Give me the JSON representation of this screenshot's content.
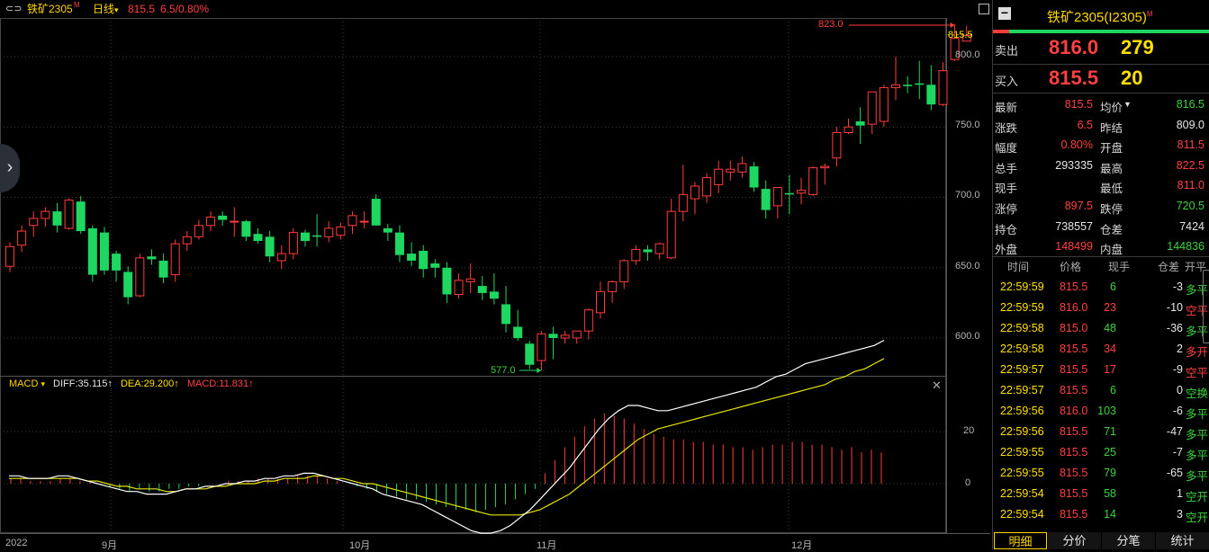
{
  "header": {
    "symbol": "铁矿2305",
    "symbol_mark": "M",
    "period": "日线",
    "period_caret": "▾",
    "price": "815.5",
    "change": "6.5/0.80%"
  },
  "price_axis": {
    "ticks": [
      "800.0",
      "750.0",
      "700.0",
      "650.0",
      "600.0"
    ],
    "current": "815.5"
  },
  "markers": {
    "high": "823.0",
    "low": "577.0"
  },
  "macd": {
    "name": "MACD",
    "caret": "▾",
    "diff": "DIFF:35.115↑",
    "dea": "DEA:29.200↑",
    "macd_val": "MACD:11.831↑",
    "ticks": [
      "20",
      "0"
    ]
  },
  "time_axis": [
    "2022",
    "9月",
    "10月",
    "11月",
    "12月"
  ],
  "chart_data": {
    "type": "candlestick",
    "ylim": [
      570,
      830
    ],
    "candles": [
      {
        "o": 651,
        "h": 668,
        "l": 647,
        "c": 665
      },
      {
        "o": 666,
        "h": 680,
        "l": 661,
        "c": 676
      },
      {
        "o": 680,
        "h": 690,
        "l": 672,
        "c": 685
      },
      {
        "o": 685,
        "h": 693,
        "l": 679,
        "c": 690
      },
      {
        "o": 690,
        "h": 696,
        "l": 675,
        "c": 680
      },
      {
        "o": 678,
        "h": 699,
        "l": 677,
        "c": 698
      },
      {
        "o": 697,
        "h": 701,
        "l": 674,
        "c": 676
      },
      {
        "o": 678,
        "h": 680,
        "l": 640,
        "c": 645
      },
      {
        "o": 675,
        "h": 679,
        "l": 645,
        "c": 648
      },
      {
        "o": 660,
        "h": 662,
        "l": 640,
        "c": 648
      },
      {
        "o": 647,
        "h": 651,
        "l": 624,
        "c": 629
      },
      {
        "o": 630,
        "h": 660,
        "l": 629,
        "c": 657
      },
      {
        "o": 658,
        "h": 663,
        "l": 652,
        "c": 656
      },
      {
        "o": 655,
        "h": 660,
        "l": 639,
        "c": 643
      },
      {
        "o": 645,
        "h": 670,
        "l": 640,
        "c": 667
      },
      {
        "o": 667,
        "h": 676,
        "l": 662,
        "c": 672
      },
      {
        "o": 672,
        "h": 684,
        "l": 670,
        "c": 680
      },
      {
        "o": 680,
        "h": 690,
        "l": 676,
        "c": 686
      },
      {
        "o": 687,
        "h": 690,
        "l": 680,
        "c": 684
      },
      {
        "o": 683,
        "h": 693,
        "l": 672,
        "c": 683
      },
      {
        "o": 683,
        "h": 684,
        "l": 669,
        "c": 672
      },
      {
        "o": 674,
        "h": 678,
        "l": 667,
        "c": 669
      },
      {
        "o": 672,
        "h": 676,
        "l": 654,
        "c": 658
      },
      {
        "o": 655,
        "h": 666,
        "l": 649,
        "c": 660
      },
      {
        "o": 660,
        "h": 678,
        "l": 656,
        "c": 675
      },
      {
        "o": 675,
        "h": 677,
        "l": 665,
        "c": 669
      },
      {
        "o": 673,
        "h": 688,
        "l": 665,
        "c": 672
      },
      {
        "o": 672,
        "h": 683,
        "l": 668,
        "c": 678
      },
      {
        "o": 673,
        "h": 682,
        "l": 670,
        "c": 679
      },
      {
        "o": 680,
        "h": 690,
        "l": 674,
        "c": 687
      },
      {
        "o": 683,
        "h": 690,
        "l": 678,
        "c": 683
      },
      {
        "o": 699,
        "h": 702,
        "l": 680,
        "c": 680
      },
      {
        "o": 678,
        "h": 681,
        "l": 669,
        "c": 675
      },
      {
        "o": 675,
        "h": 680,
        "l": 654,
        "c": 659
      },
      {
        "o": 660,
        "h": 668,
        "l": 651,
        "c": 655
      },
      {
        "o": 662,
        "h": 666,
        "l": 643,
        "c": 649
      },
      {
        "o": 653,
        "h": 656,
        "l": 643,
        "c": 650
      },
      {
        "o": 650,
        "h": 654,
        "l": 625,
        "c": 631
      },
      {
        "o": 631,
        "h": 646,
        "l": 628,
        "c": 641
      },
      {
        "o": 640,
        "h": 653,
        "l": 632,
        "c": 642
      },
      {
        "o": 637,
        "h": 644,
        "l": 627,
        "c": 632
      },
      {
        "o": 633,
        "h": 646,
        "l": 624,
        "c": 628
      },
      {
        "o": 624,
        "h": 637,
        "l": 604,
        "c": 610
      },
      {
        "o": 608,
        "h": 620,
        "l": 598,
        "c": 600
      },
      {
        "o": 596,
        "h": 598,
        "l": 578,
        "c": 581
      },
      {
        "o": 584,
        "h": 605,
        "l": 577,
        "c": 603
      },
      {
        "o": 603,
        "h": 608,
        "l": 585,
        "c": 600
      },
      {
        "o": 600,
        "h": 605,
        "l": 596,
        "c": 602
      },
      {
        "o": 600,
        "h": 605,
        "l": 596,
        "c": 605
      },
      {
        "o": 605,
        "h": 621,
        "l": 599,
        "c": 620
      },
      {
        "o": 618,
        "h": 640,
        "l": 614,
        "c": 633
      },
      {
        "o": 633,
        "h": 641,
        "l": 625,
        "c": 640
      },
      {
        "o": 640,
        "h": 656,
        "l": 635,
        "c": 655
      },
      {
        "o": 655,
        "h": 666,
        "l": 652,
        "c": 663
      },
      {
        "o": 663,
        "h": 666,
        "l": 655,
        "c": 661
      },
      {
        "o": 660,
        "h": 668,
        "l": 656,
        "c": 667
      },
      {
        "o": 657,
        "h": 699,
        "l": 656,
        "c": 690
      },
      {
        "o": 690,
        "h": 723,
        "l": 683,
        "c": 702
      },
      {
        "o": 699,
        "h": 711,
        "l": 688,
        "c": 708
      },
      {
        "o": 701,
        "h": 717,
        "l": 696,
        "c": 714
      },
      {
        "o": 709,
        "h": 726,
        "l": 703,
        "c": 720
      },
      {
        "o": 718,
        "h": 726,
        "l": 712,
        "c": 720
      },
      {
        "o": 718,
        "h": 729,
        "l": 714,
        "c": 724
      },
      {
        "o": 722,
        "h": 725,
        "l": 704,
        "c": 707
      },
      {
        "o": 706,
        "h": 712,
        "l": 685,
        "c": 691
      },
      {
        "o": 694,
        "h": 707,
        "l": 685,
        "c": 707
      },
      {
        "o": 703,
        "h": 716,
        "l": 688,
        "c": 702
      },
      {
        "o": 703,
        "h": 714,
        "l": 695,
        "c": 705
      },
      {
        "o": 702,
        "h": 722,
        "l": 701,
        "c": 721
      },
      {
        "o": 721,
        "h": 724,
        "l": 709,
        "c": 722
      },
      {
        "o": 728,
        "h": 750,
        "l": 722,
        "c": 746
      },
      {
        "o": 746,
        "h": 756,
        "l": 745,
        "c": 750
      },
      {
        "o": 754,
        "h": 764,
        "l": 738,
        "c": 751
      },
      {
        "o": 752,
        "h": 772,
        "l": 745,
        "c": 775
      },
      {
        "o": 754,
        "h": 780,
        "l": 750,
        "c": 778
      },
      {
        "o": 778,
        "h": 800,
        "l": 769,
        "c": 780
      },
      {
        "o": 780,
        "h": 786,
        "l": 774,
        "c": 779
      },
      {
        "o": 781,
        "h": 797,
        "l": 770,
        "c": 780
      },
      {
        "o": 780,
        "h": 794,
        "l": 762,
        "c": 766
      },
      {
        "o": 766,
        "h": 796,
        "l": 765,
        "c": 790
      },
      {
        "o": 798,
        "h": 823,
        "l": 797,
        "c": 813
      },
      {
        "o": 811,
        "h": 822,
        "l": 811,
        "c": 815
      }
    ],
    "macd": {
      "diff": [
        3,
        3,
        2,
        2,
        2,
        3,
        3,
        2,
        1,
        0,
        -1,
        -2,
        -3,
        -3,
        -4,
        -4,
        -4,
        -3,
        -2,
        -2,
        -1,
        -1,
        0,
        0,
        1,
        1,
        2,
        2,
        3,
        3,
        4,
        4,
        3,
        2,
        1,
        0,
        -1,
        -2,
        -4,
        -5,
        -6,
        -7,
        -8,
        -10,
        -12,
        -14,
        -16,
        -18,
        -19,
        -19,
        -18,
        -16,
        -13,
        -10,
        -6,
        -2,
        2,
        6,
        11,
        16,
        21,
        25,
        28,
        30,
        30,
        29,
        28,
        28,
        29,
        30,
        31,
        32,
        33,
        34,
        35,
        36,
        37,
        39,
        41,
        42,
        44,
        46,
        47,
        48,
        49,
        50,
        51,
        52,
        53,
        55
      ],
      "dea": [
        2,
        2,
        2,
        2,
        2,
        2,
        2,
        2,
        1,
        1,
        0,
        -1,
        -1,
        -2,
        -2,
        -2,
        -3,
        -3,
        -2,
        -2,
        -2,
        -1,
        -1,
        0,
        0,
        0,
        1,
        1,
        2,
        2,
        2,
        3,
        3,
        2,
        2,
        1,
        0,
        0,
        -1,
        -2,
        -3,
        -4,
        -5,
        -6,
        -7,
        -8,
        -9,
        -10,
        -11,
        -12,
        -12,
        -12,
        -12,
        -11,
        -10,
        -8,
        -6,
        -4,
        -1,
        2,
        5,
        8,
        11,
        14,
        17,
        19,
        21,
        22,
        23,
        24,
        25,
        26,
        27,
        28,
        29,
        30,
        31,
        32,
        33,
        34,
        35,
        36,
        37,
        38,
        40,
        41,
        43,
        44,
        46,
        48
      ],
      "hist": [
        2,
        2,
        1,
        1,
        1,
        2,
        2,
        1,
        1,
        0,
        -1,
        -2,
        -3,
        -2,
        -3,
        -3,
        -2,
        -2,
        -1,
        -1,
        0,
        0,
        1,
        1,
        1,
        2,
        2,
        2,
        2,
        3,
        3,
        3,
        2,
        1,
        0,
        -1,
        -2,
        -3,
        -4,
        -5,
        -6,
        -6,
        -7,
        -8,
        -9,
        -10,
        -10,
        -11,
        -10,
        -9,
        -8,
        -6,
        -4,
        -2,
        4,
        9,
        14,
        18,
        22,
        25,
        27,
        26,
        25,
        23,
        21,
        19,
        18,
        17,
        17,
        16,
        16,
        15,
        15,
        14,
        14,
        13,
        14,
        15,
        15,
        16,
        16,
        15,
        15,
        14,
        13,
        14,
        12,
        13,
        12
      ]
    },
    "x_months": [
      "9月",
      "10月",
      "11月",
      "12月"
    ]
  },
  "panel": {
    "minus_icon": "−",
    "title": "铁矿2305(I2305)",
    "title_mark": "M",
    "sell_label": "卖出",
    "sell_price": "816.0",
    "sell_qty": "279",
    "buy_label": "买入",
    "buy_price": "815.5",
    "buy_qty": "20",
    "stats": [
      {
        "l1": "最新",
        "v1": "815.5",
        "c1": "red",
        "l2": "均价",
        "v2": "816.5",
        "c2": "green",
        "arrow": "▼"
      },
      {
        "l1": "涨跌",
        "v1": "6.5",
        "c1": "red",
        "l2": "昨结",
        "v2": "809.0",
        "c2": "white",
        "arrow": ""
      },
      {
        "l1": "幅度",
        "v1": "0.80%",
        "c1": "red",
        "l2": "开盘",
        "v2": "811.5",
        "c2": "red",
        "arrow": ""
      },
      {
        "l1": "总手",
        "v1": "293335",
        "c1": "white",
        "l2": "最高",
        "v2": "822.5",
        "c2": "red",
        "arrow": ""
      },
      {
        "l1": "现手",
        "v1": "",
        "c1": "white",
        "l2": "最低",
        "v2": "811.0",
        "c2": "red",
        "arrow": ""
      },
      {
        "l1": "涨停",
        "v1": "897.5",
        "c1": "red",
        "l2": "跌停",
        "v2": "720.5",
        "c2": "green",
        "arrow": ""
      },
      {
        "l1": "持仓",
        "v1": "738557",
        "c1": "white",
        "l2": "仓差",
        "v2": "7424",
        "c2": "white",
        "arrow": ""
      },
      {
        "l1": "外盘",
        "v1": "148499",
        "c1": "red",
        "l2": "内盘",
        "v2": "144836",
        "c2": "green",
        "arrow": ""
      }
    ],
    "table_header": [
      "时间",
      "价格",
      "现手",
      "仓差",
      "开平"
    ],
    "trades": [
      {
        "time": "22:59:59",
        "price": "815.5",
        "pc": "red",
        "qty": "6",
        "qc": "green",
        "diff": "-3",
        "kind": "多平",
        "kc": "green"
      },
      {
        "time": "22:59:59",
        "price": "816.0",
        "pc": "red",
        "qty": "23",
        "qc": "red",
        "diff": "-10",
        "kind": "空平",
        "kc": "red"
      },
      {
        "time": "22:59:58",
        "price": "815.0",
        "pc": "red",
        "qty": "48",
        "qc": "green",
        "diff": "-36",
        "kind": "多平",
        "kc": "green"
      },
      {
        "time": "22:59:58",
        "price": "815.5",
        "pc": "red",
        "qty": "34",
        "qc": "red",
        "diff": "2",
        "kind": "多开",
        "kc": "red"
      },
      {
        "time": "22:59:57",
        "price": "815.5",
        "pc": "red",
        "qty": "17",
        "qc": "red",
        "diff": "-9",
        "kind": "空平",
        "kc": "red"
      },
      {
        "time": "22:59:57",
        "price": "815.5",
        "pc": "red",
        "qty": "6",
        "qc": "green",
        "diff": "0",
        "kind": "空换",
        "kc": "green"
      },
      {
        "time": "22:59:56",
        "price": "816.0",
        "pc": "red",
        "qty": "103",
        "qc": "green",
        "diff": "-6",
        "kind": "多平",
        "kc": "green"
      },
      {
        "time": "22:59:56",
        "price": "815.5",
        "pc": "red",
        "qty": "71",
        "qc": "green",
        "diff": "-47",
        "kind": "多平",
        "kc": "green"
      },
      {
        "time": "22:59:55",
        "price": "815.5",
        "pc": "red",
        "qty": "25",
        "qc": "green",
        "diff": "-7",
        "kind": "多平",
        "kc": "green"
      },
      {
        "time": "22:59:55",
        "price": "815.5",
        "pc": "red",
        "qty": "79",
        "qc": "green",
        "diff": "-65",
        "kind": "多平",
        "kc": "green"
      },
      {
        "time": "22:59:54",
        "price": "815.5",
        "pc": "red",
        "qty": "58",
        "qc": "green",
        "diff": "1",
        "kind": "空开",
        "kc": "green"
      },
      {
        "time": "22:59:54",
        "price": "815.5",
        "pc": "red",
        "qty": "14",
        "qc": "green",
        "diff": "3",
        "kind": "空开",
        "kc": "green"
      }
    ],
    "tabs": [
      "明细",
      "分价",
      "分笔",
      "统计"
    ]
  },
  "icons": {
    "maximize": "maximize-icon",
    "close": "close-icon",
    "nav_arrow": "chevron-right-icon"
  },
  "colors": {
    "up": "#ff3c3c",
    "down": "#1ed760",
    "diff_line": "#ffffff",
    "dea_line": "#e6e600",
    "grid": "#3c3c3c"
  }
}
